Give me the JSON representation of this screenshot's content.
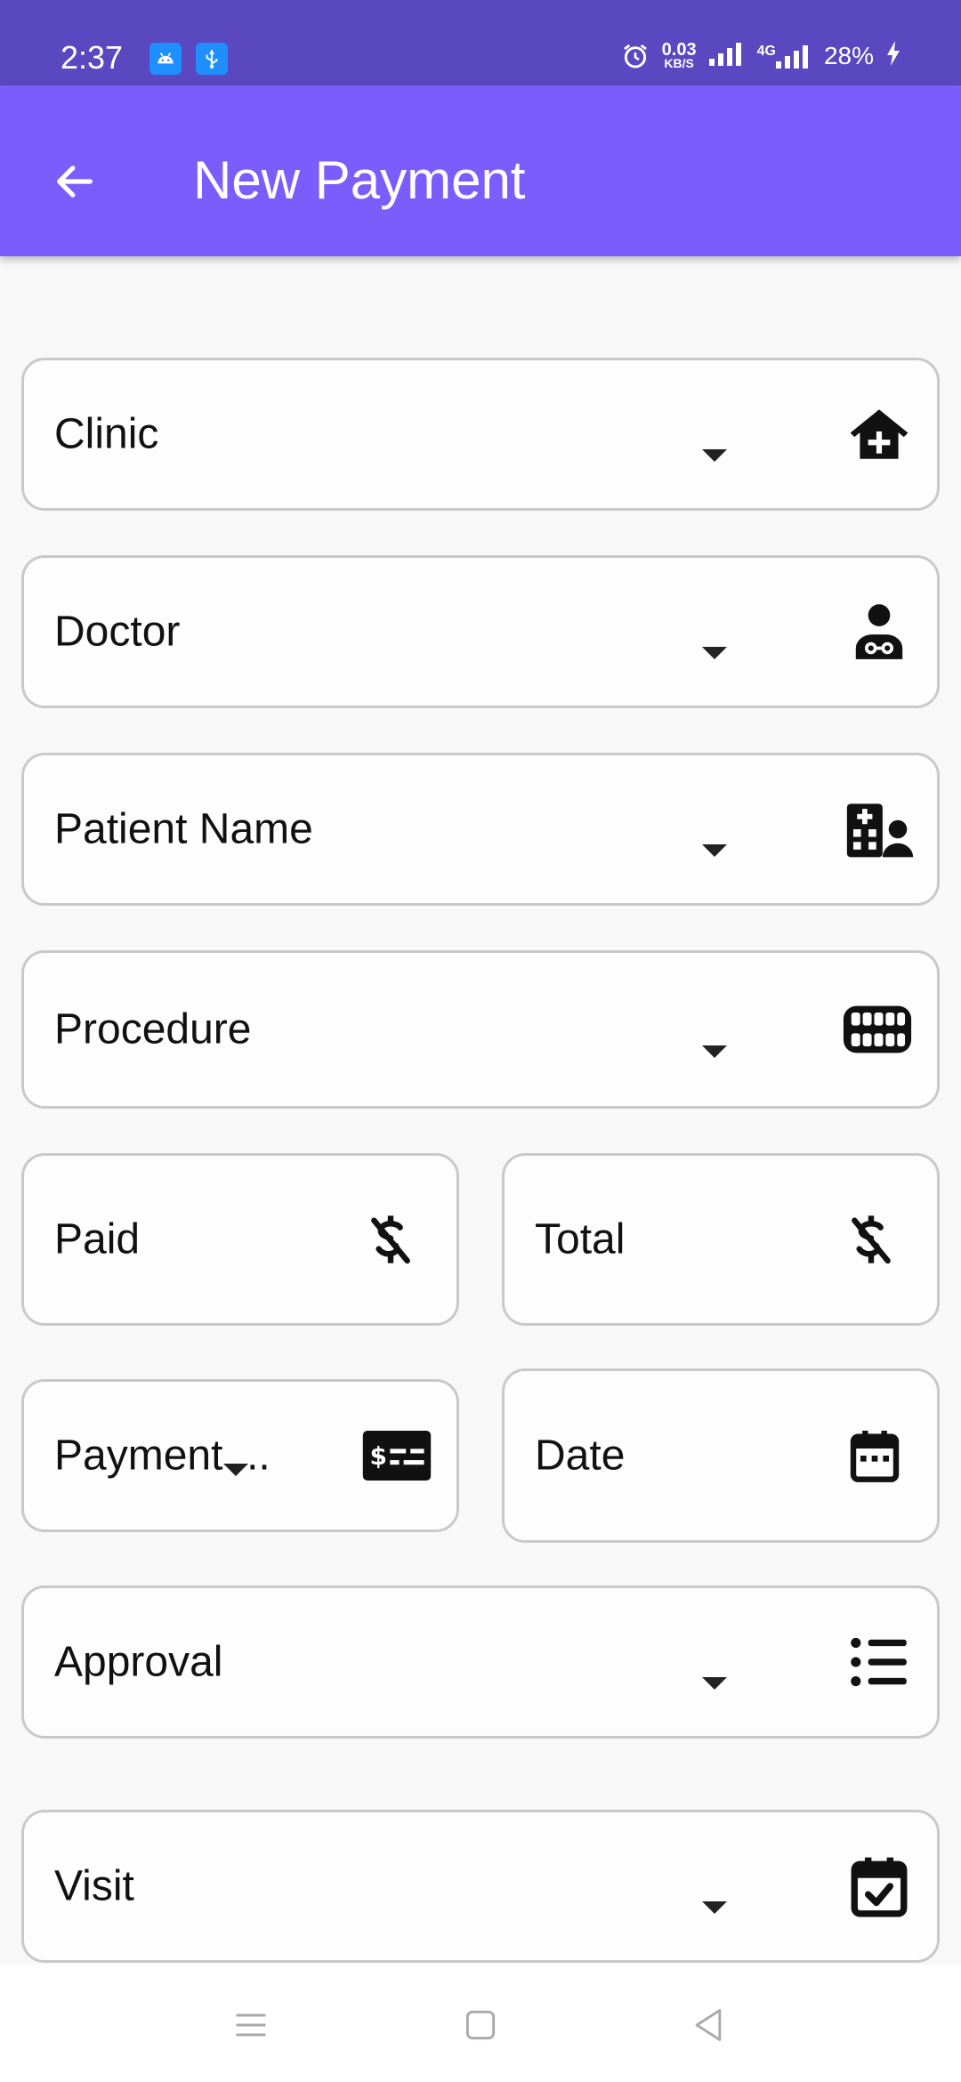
{
  "status_bar": {
    "time": "2:37",
    "net_speed_value": "0.03",
    "net_speed_unit": "KB/S",
    "network_type": "4G",
    "battery": "28%",
    "icons": [
      "android-debug-icon",
      "usb-icon",
      "alarm-icon",
      "signal-icon",
      "signal-4g-icon",
      "charging-bolt-icon"
    ]
  },
  "app_bar": {
    "title": "New Payment",
    "back_icon": "arrow-left-icon",
    "background_color": "#7b5cfd",
    "status_color": "#5948c0"
  },
  "form": {
    "clinic": {
      "label": "Clinic",
      "icon": "clinic-house-icon"
    },
    "doctor": {
      "label": "Doctor",
      "icon": "doctor-icon"
    },
    "patient_name": {
      "label": "Patient Name",
      "icon": "hospital-user-icon"
    },
    "procedure": {
      "label": "Procedure",
      "icon": "teeth-icon"
    },
    "paid": {
      "label": "Paid",
      "icon": "dollar-off-icon"
    },
    "total": {
      "label": "Total",
      "icon": "dollar-off-icon"
    },
    "payment_method": {
      "label": "Payment ...",
      "icon": "money-check-icon"
    },
    "date": {
      "label": "Date",
      "icon": "calendar-icon"
    },
    "approval": {
      "label": "Approval",
      "icon": "list-icon"
    },
    "visit": {
      "label": "Visit",
      "icon": "calendar-check-icon"
    }
  },
  "nav_bar": {
    "icons": [
      "menu-lines-icon",
      "home-square-icon",
      "back-triangle-icon"
    ]
  }
}
